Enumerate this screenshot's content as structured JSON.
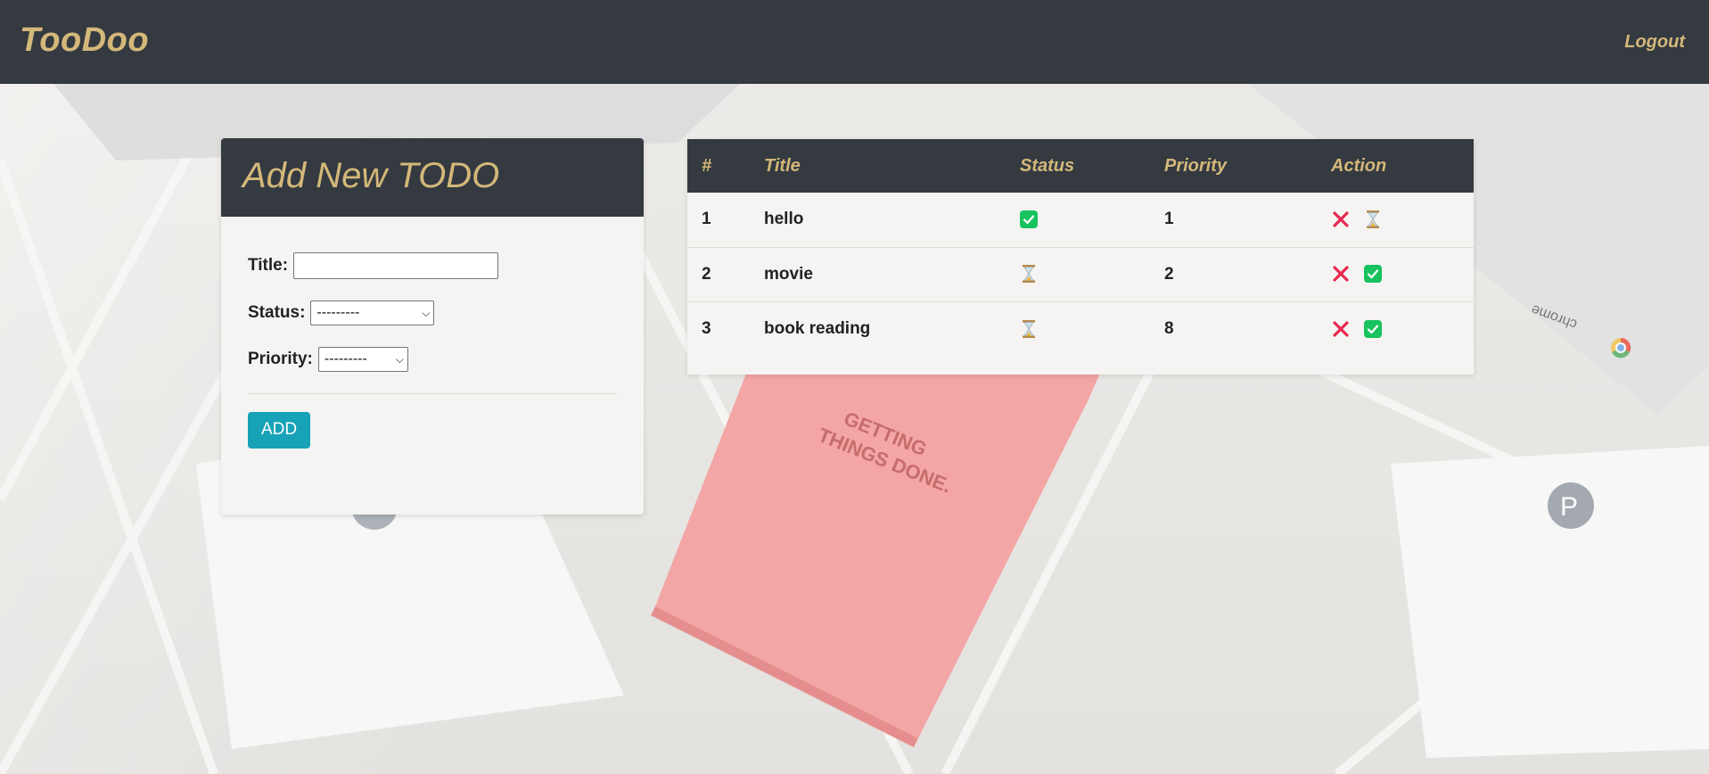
{
  "navbar": {
    "brand": "TooDoo",
    "logout": "Logout"
  },
  "form": {
    "title": "Add New TODO",
    "title_label": "Title:",
    "title_value": "",
    "status_label": "Status:",
    "status_selected": "---------",
    "priority_label": "Priority:",
    "priority_selected": "---------",
    "add_label": "ADD"
  },
  "table": {
    "headers": [
      "#",
      "Title",
      "Status",
      "Priority",
      "Action"
    ],
    "rows": [
      {
        "num": "1",
        "title": "hello",
        "status": "done",
        "priority": "1",
        "action_toggle": "hourglass"
      },
      {
        "num": "2",
        "title": "movie",
        "status": "pending",
        "priority": "2",
        "action_toggle": "check"
      },
      {
        "num": "3",
        "title": "book reading",
        "status": "pending",
        "priority": "8",
        "action_toggle": "check"
      }
    ]
  },
  "colors": {
    "nav_bg": "#343a40",
    "accent_gold": "#d4b87a",
    "add_button": "#17a2b8",
    "check_green": "#18c35f",
    "delete_red": "#e8284f"
  },
  "background_art": {
    "book_text": "GETTING THINGS DONE.",
    "laptop_logo_text": "chrome"
  }
}
